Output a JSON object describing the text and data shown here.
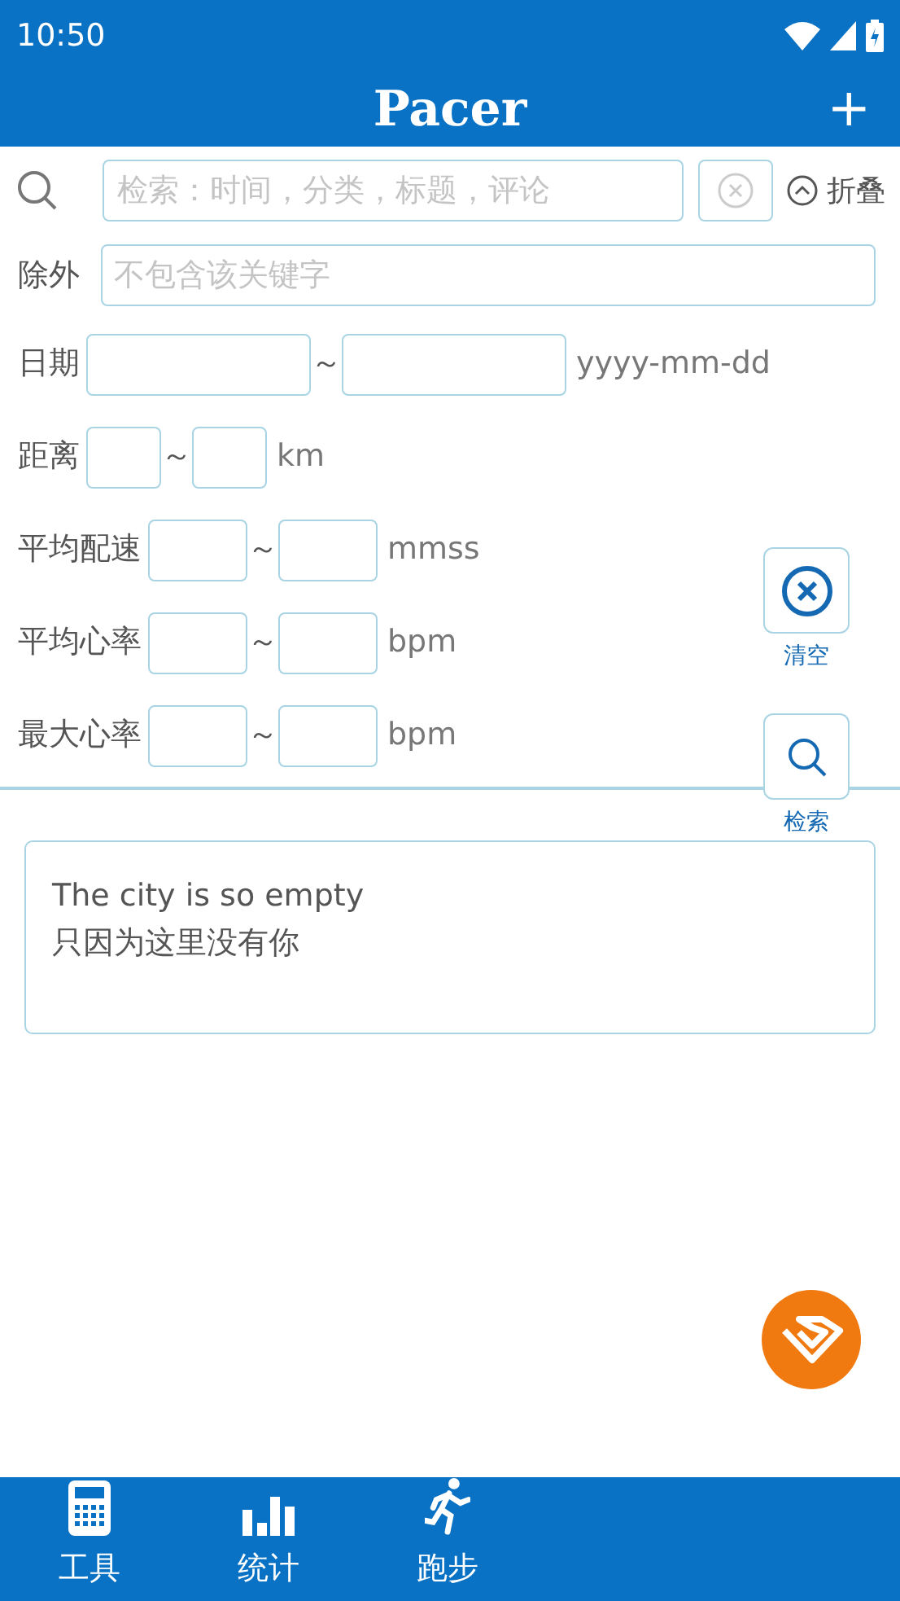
{
  "status_bar": {
    "time": "10:50"
  },
  "app_bar": {
    "title": "Pacer",
    "action": "+"
  },
  "search": {
    "placeholder": "检索：时间，分类，标题，评论",
    "collapse_label": "折叠"
  },
  "exclude": {
    "label": "除外",
    "placeholder": "不包含该关键字"
  },
  "ranges": [
    {
      "label": "日期",
      "separator": "～",
      "unit": "yyyy-mm-dd",
      "kind": "wide"
    },
    {
      "label": "距离",
      "separator": "～",
      "unit": "km",
      "kind": "narrow"
    },
    {
      "label": "平均配速",
      "separator": "～",
      "unit": "mmss",
      "kind": "medium"
    },
    {
      "label": "平均心率",
      "separator": "～",
      "unit": "bpm",
      "kind": "medium"
    },
    {
      "label": "最大心率",
      "separator": "～",
      "unit": "bpm",
      "kind": "medium"
    }
  ],
  "side_buttons": [
    {
      "label": "清空",
      "kind": "clear"
    },
    {
      "label": "检索",
      "kind": "search"
    }
  ],
  "note": {
    "lines": [
      "The city is so empty",
      "只因为这里没有你"
    ]
  },
  "bottom_nav": [
    {
      "label": "工具",
      "kind": "calculator"
    },
    {
      "label": "统计",
      "kind": "chart"
    },
    {
      "label": "跑步",
      "kind": "runner"
    }
  ]
}
